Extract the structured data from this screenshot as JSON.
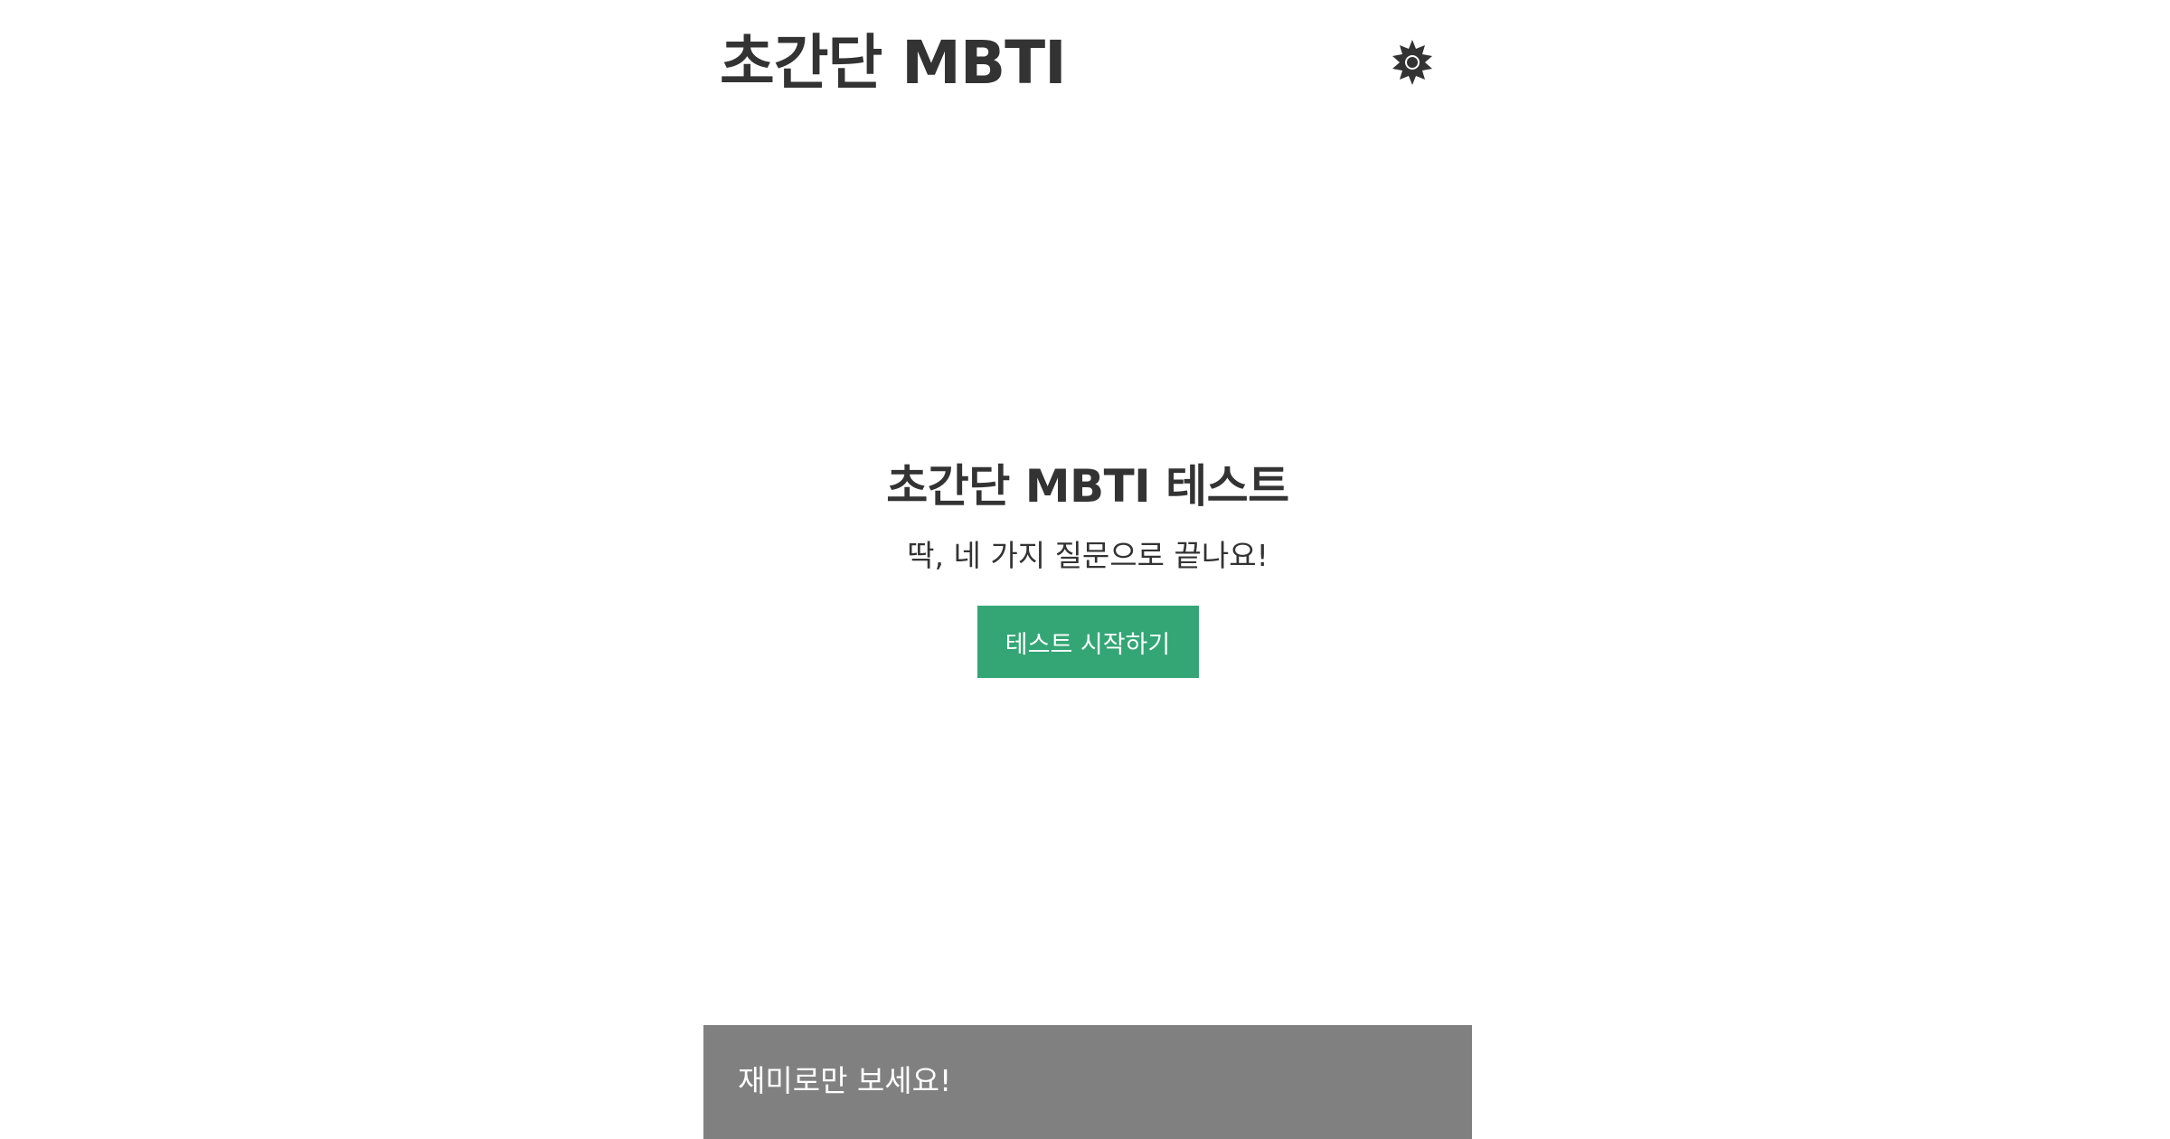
{
  "header": {
    "app_title": "초간단 MBTI",
    "theme_toggle_icon": "sun-gear-icon"
  },
  "hero": {
    "title": "초간단 MBTI 테스트",
    "subtitle": "딱, 네 가지 질문으로 끝나요!",
    "start_button_label": "테스트 시작하기"
  },
  "footer": {
    "notice": "재미로만 보세요!"
  },
  "colors": {
    "text": "#333333",
    "accent": "#34a676",
    "footer_background": "#808080",
    "background": "#ffffff"
  }
}
